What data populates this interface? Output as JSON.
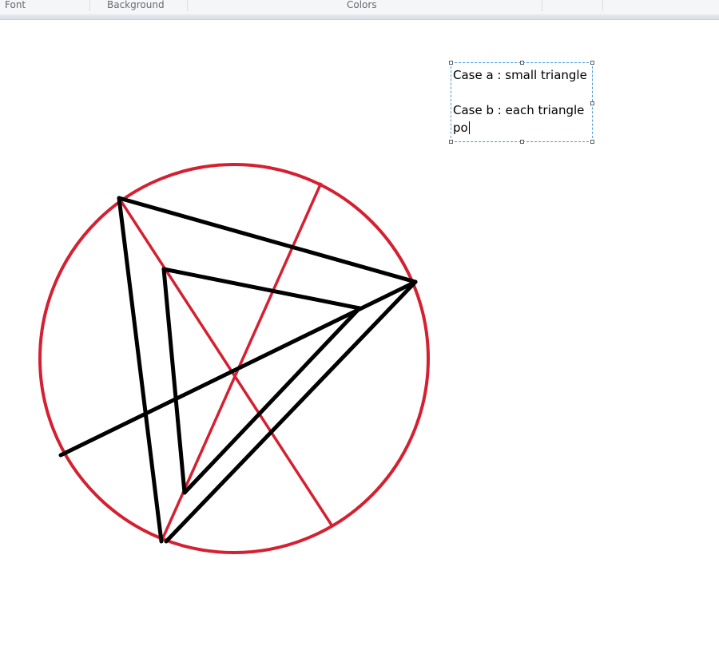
{
  "ribbon": {
    "groups": [
      {
        "label": "Font"
      },
      {
        "label": "Background"
      },
      {
        "label": "Colors"
      }
    ]
  },
  "text_box": {
    "lines": [
      "Case a : small triangle",
      "",
      "Case b : each triangle",
      "po"
    ]
  },
  "colors": {
    "circle": "#d42030",
    "red_lines": "#d42030",
    "black_lines": "#000000",
    "selection_border": "#4a9ad6"
  }
}
